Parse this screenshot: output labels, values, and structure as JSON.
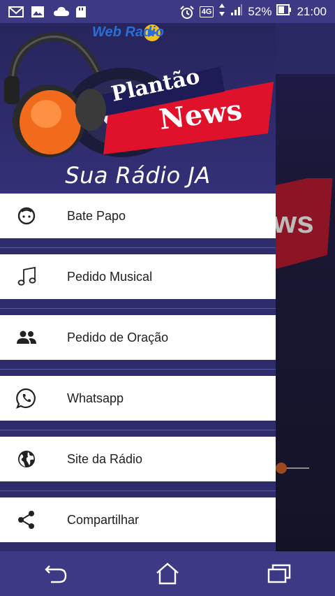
{
  "status_bar": {
    "left_icons": [
      "gmail-icon",
      "image-icon",
      "cloud-icon",
      "sd-card-icon"
    ],
    "alarm_icon": "alarm-icon",
    "network": "4G",
    "battery_percent": "52%",
    "time": "21:00"
  },
  "drawer": {
    "logo": {
      "web_radio": "Web Radio",
      "brand_line1": "Plantão",
      "brand_line2": "News"
    },
    "tagline": "Sua Rádio JA",
    "items": [
      {
        "label": "Bate Papo",
        "icon": "chat-face-icon"
      },
      {
        "label": "Pedido Musical",
        "icon": "music-note-icon"
      },
      {
        "label": "Pedido de Oração",
        "icon": "people-icon"
      },
      {
        "label": "Whatsapp",
        "icon": "whatsapp-icon"
      },
      {
        "label": "Site da Rádio",
        "icon": "globe-icon"
      },
      {
        "label": "Compartilhar",
        "icon": "share-icon"
      }
    ]
  },
  "background_app": {
    "banner_partial_text": "s"
  },
  "nav_bar": {
    "buttons": [
      "back-icon",
      "home-icon",
      "recents-icon"
    ]
  },
  "colors": {
    "status_bar": "#3c3a85",
    "drawer_bg": "#2e2c6b",
    "menu_item_bg": "#ffffff",
    "brand_red": "#e0122b",
    "brand_orange": "#f26b1d"
  }
}
